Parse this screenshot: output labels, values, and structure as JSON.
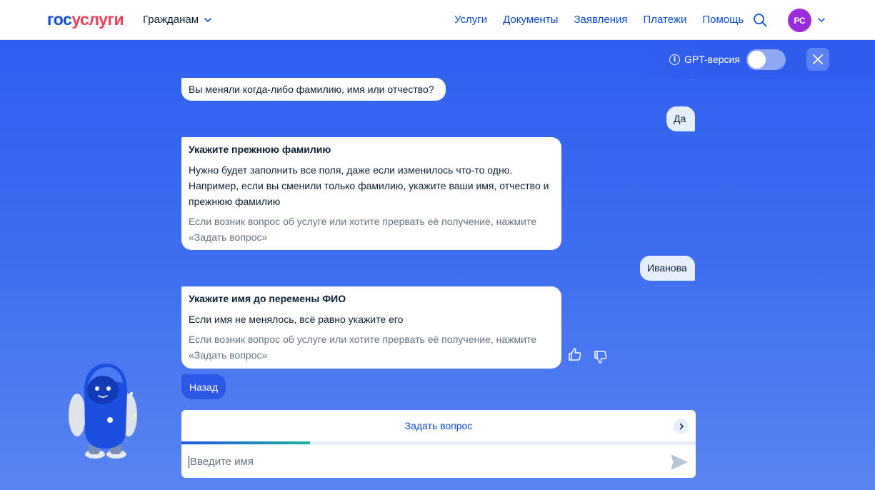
{
  "header": {
    "logo_part1": "гос",
    "logo_part2": "услуги",
    "audience": "Гражданам",
    "nav": [
      "Услуги",
      "Документы",
      "Заявления",
      "Платежи",
      "Помощь"
    ],
    "avatar_initials": "РС"
  },
  "chat": {
    "gpt_label": "GPT-версия",
    "gpt_enabled": false,
    "messages": [
      {
        "from": "bot",
        "text": "Вы меняли когда-либо фамилию, имя или отчество?"
      },
      {
        "from": "user",
        "text": "Да"
      },
      {
        "from": "bot",
        "title": "Укажите прежнюю фамилию",
        "text": "Нужно будет заполнить все поля, даже если изменилось что-то одно. Например, если вы сменили только фамилию, укажите ваши имя, отчество и прежнюю фамилию",
        "hint": "Если возник вопрос об услуге или хотите прервать её получение, нажмите «Задать вопрос»"
      },
      {
        "from": "user",
        "text": "Иванова"
      },
      {
        "from": "bot",
        "title": "Укажите имя до перемены ФИО",
        "text": "Если имя не менялось, всё равно укажите его",
        "hint": "Если возник вопрос об услуге или хотите прервать её получение, нажмите «Задать вопрос»"
      }
    ],
    "back_label": "Назад",
    "ask_label": "Задать вопрос",
    "progress": 0.25,
    "input_placeholder": "Введите имя",
    "input_value": ""
  }
}
